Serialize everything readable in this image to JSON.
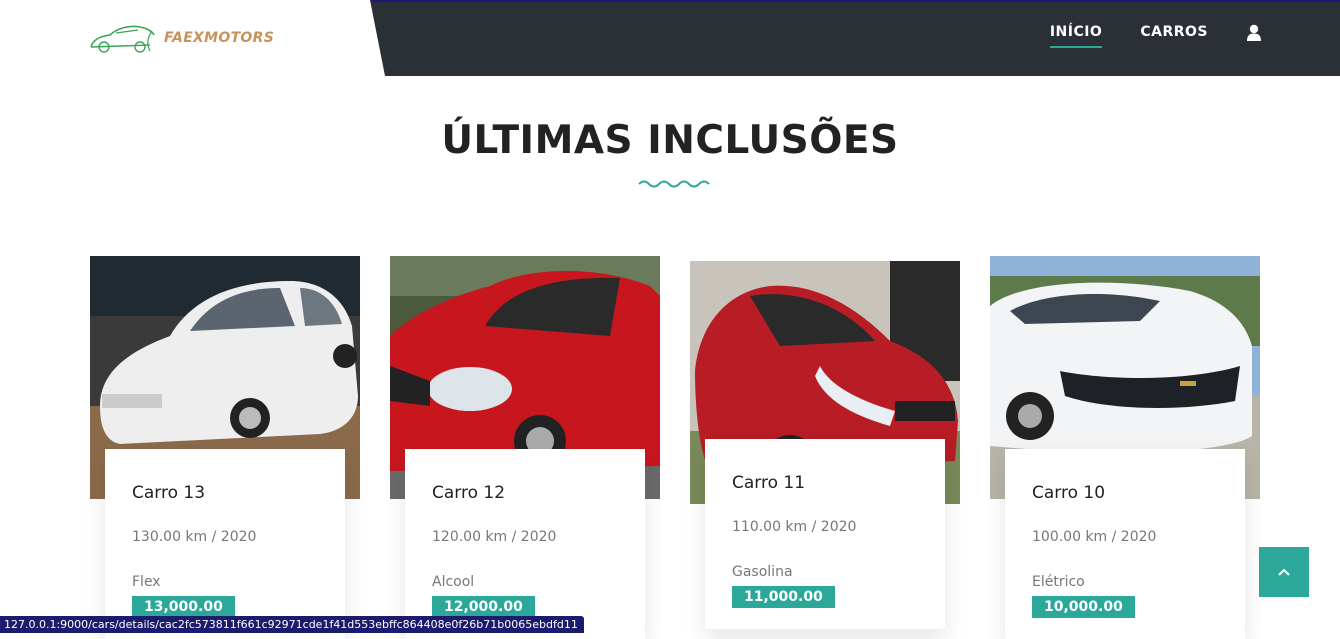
{
  "header": {
    "logo_text": "FAEXMOTORS",
    "nav": [
      {
        "label": "INÍCIO",
        "active": true
      },
      {
        "label": "CARROS",
        "active": false
      }
    ],
    "user_icon": "user-icon"
  },
  "section": {
    "title": "ÚLTIMAS INCLUSÕES"
  },
  "cars": [
    {
      "name": "Carro 13",
      "meta": "130.00 km / 2020",
      "fuel": "Flex",
      "price": "13,000.00",
      "color": "white-sedan"
    },
    {
      "name": "Carro 12",
      "meta": "120.00 km / 2020",
      "fuel": "Alcool",
      "price": "12,000.00",
      "color": "red-hatch"
    },
    {
      "name": "Carro 11",
      "meta": "110.00 km / 2020",
      "fuel": "Gasolina",
      "price": "11,000.00",
      "color": "red-hatch"
    },
    {
      "name": "Carro 10",
      "meta": "100.00 km / 2020",
      "fuel": "Elétrico",
      "price": "10,000.00",
      "color": "white-coupe"
    }
  ],
  "status_url": "127.0.0.1:9000/cars/details/cac2fc573811f661c92971cde1f41d553ebffc864408e0f26b71b0065ebdfd11",
  "colors": {
    "accent": "#2ba89a",
    "header_bg": "#2b2f36",
    "logo": "#c9925b"
  }
}
